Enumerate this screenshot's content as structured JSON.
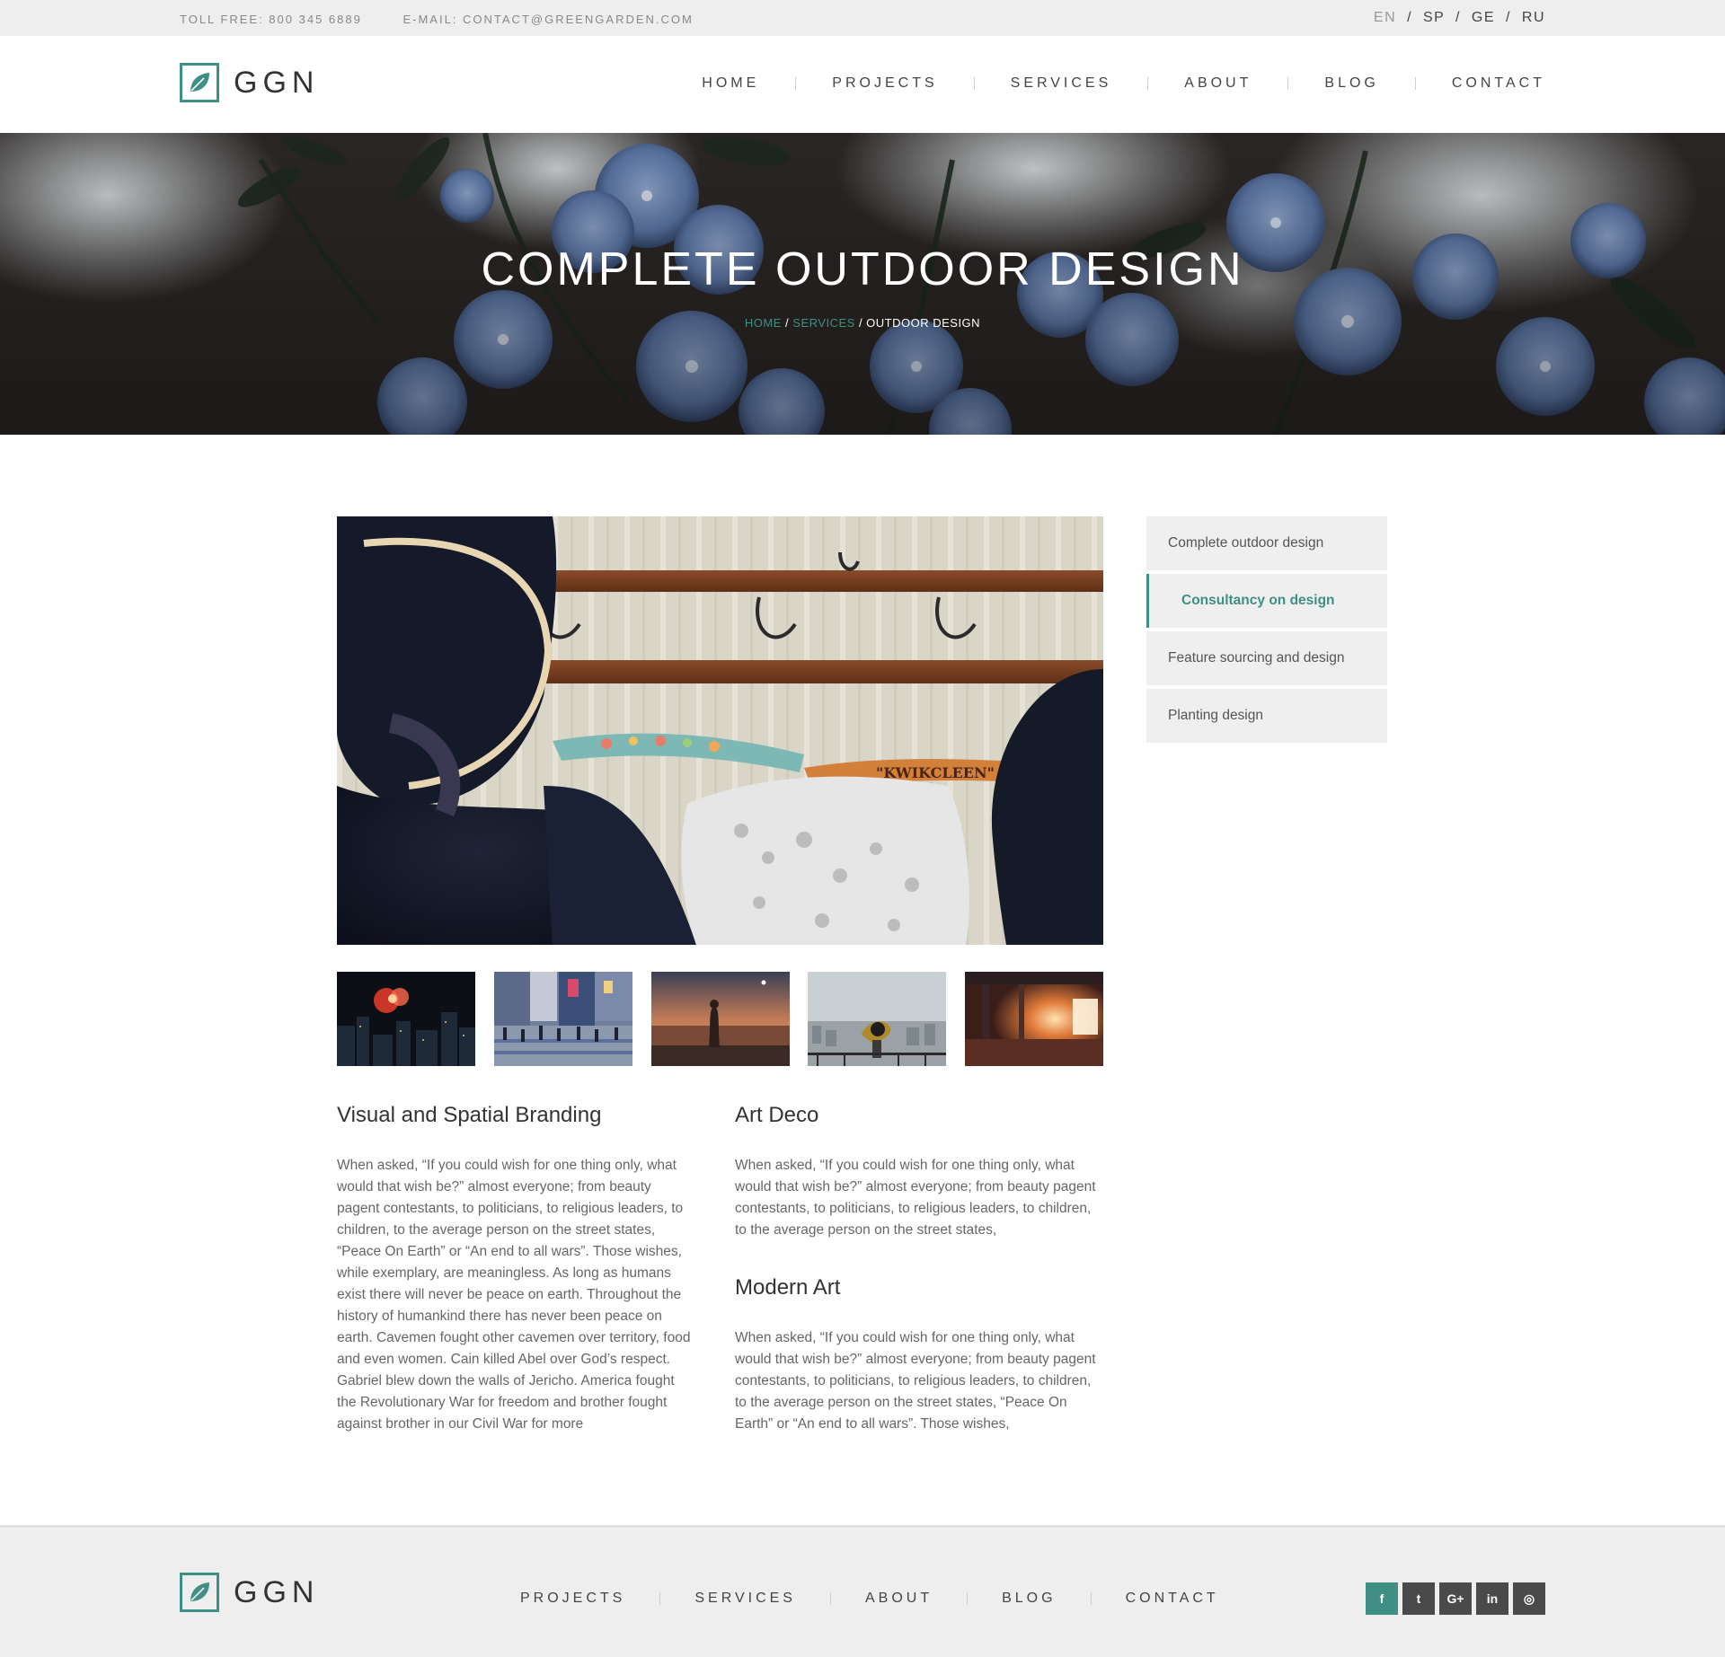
{
  "topbar": {
    "toll_free": "TOLL FREE: 800 345 6889",
    "email": "E-MAIL: CONTACT@GREENGARDEN.COM",
    "languages": [
      "EN",
      "SP",
      "GE",
      "RU"
    ],
    "active_language": "EN",
    "lang_separator": "/"
  },
  "brand": {
    "logo_text": "GGN",
    "accent_color": "#3f8f84"
  },
  "nav": {
    "items": [
      "HOME",
      "PROJECTS",
      "SERVICES",
      "ABOUT",
      "BLOG",
      "CONTACT"
    ]
  },
  "hero": {
    "title": "COMPLETE OUTDOOR DESIGN",
    "breadcrumb": {
      "home": "HOME",
      "sep": "/",
      "services": "SERVICES",
      "current": "/ OUTDOOR DESIGN"
    }
  },
  "sidebar": {
    "items": [
      "Complete outdoor design",
      "Consultancy on design",
      "Feature sourcing and design",
      "Planting design"
    ],
    "active_index": 1
  },
  "content": {
    "left": {
      "title": "Visual and Spatial Branding",
      "body": "When asked, “If you could wish for one thing only, what would that wish be?” almost everyone; from beauty pagent contestants, to politicians, to religious leaders, to children, to the average person on the street states, “Peace On Earth” or “An end to all wars”. Those wishes, while exemplary, are meaningless. As long as humans exist there will never be peace on earth. Throughout the history of humankind there has never been peace on earth. Cavemen fought other cavemen over territory, food and even women. Cain killed Abel over God’s respect. Gabriel blew down the walls of Jericho. America fought the Revolutionary War for freedom and brother fought against brother in our Civil War for more"
    },
    "right_top": {
      "title": "Art Deco",
      "body": "When asked, “If you could wish for one thing only, what would that wish be?” almost everyone; from beauty pagent contestants, to politicians, to religious leaders, to children, to the average person on the street states,"
    },
    "right_bottom": {
      "title": "Modern Art",
      "body": "When asked, “If you could wish for one thing only, what would that wish be?” almost everyone; from beauty pagent contestants, to politicians, to religious leaders, to children, to the average person on the street states, “Peace On Earth” or “An end to all wars”. Those wishes,"
    }
  },
  "gallery": {
    "main_image_text": "\"KWIKCLEEN\"",
    "thumbnails": [
      "fireworks-city",
      "crowd-crossing",
      "sunset-cityview",
      "binocular-viewer",
      "sunset-room"
    ]
  },
  "footer": {
    "logo_text": "GGN",
    "nav_items": [
      "PROJECTS",
      "SERVICES",
      "ABOUT",
      "BLOG",
      "CONTACT"
    ],
    "social": [
      {
        "icon": "facebook-icon",
        "glyph": "f"
      },
      {
        "icon": "twitter-icon",
        "glyph": "t"
      },
      {
        "icon": "google-plus-icon",
        "glyph": "G+"
      },
      {
        "icon": "linkedin-icon",
        "glyph": "in"
      },
      {
        "icon": "instagram-icon",
        "glyph": "◎"
      }
    ]
  }
}
